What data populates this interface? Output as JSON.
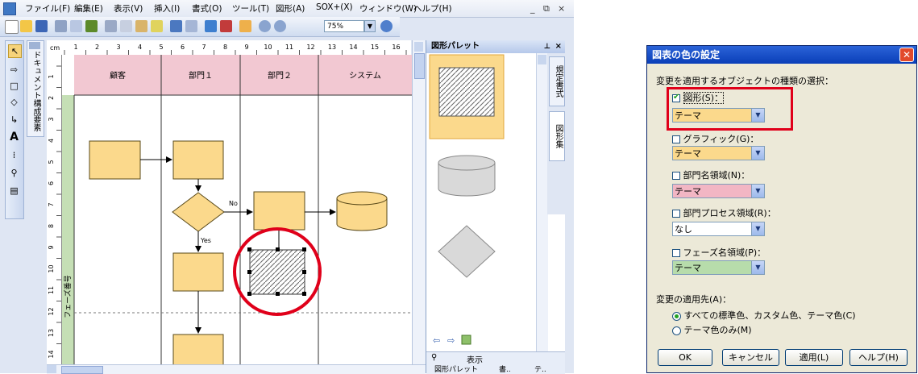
{
  "menu": {
    "items": [
      "ファイル(F)",
      "編集(E)",
      "表示(V)",
      "挿入(I)",
      "書式(O)",
      "ツール(T)",
      "図形(A)",
      "SOX+(X)",
      "ウィンドウ(W)",
      "ヘルプ(H)"
    ],
    "window_controls": [
      "_",
      "⧉",
      "×"
    ]
  },
  "toolbar": {
    "zoom": "75%"
  },
  "left_panel": {
    "label": "ドキュメント構成要素"
  },
  "ruler": {
    "unit": "cm",
    "h_ticks": [
      "1",
      "2",
      "3",
      "4",
      "5",
      "6",
      "7",
      "8",
      "9",
      "10",
      "11",
      "12",
      "13",
      "14",
      "15",
      "16",
      "1"
    ],
    "v_ticks": [
      "1",
      "2",
      "3",
      "4",
      "5",
      "6",
      "7",
      "8",
      "9",
      "10",
      "11",
      "12",
      "13",
      "14"
    ]
  },
  "diagram": {
    "lanes": [
      "顧客",
      "部門１",
      "部門２",
      "システム"
    ],
    "phase_label": "フェーズ番号",
    "yes_label": "Yes",
    "no_label": "No",
    "colors": {
      "lane_header": "#f2c8d2",
      "shape_fill": "#fbd98c",
      "shape_stroke": "#5a4a1a",
      "phase_band": "#c5dfb5",
      "highlight": "#e0001a"
    }
  },
  "palette": {
    "title": "図形パレット",
    "tabs": [
      "規定書式",
      "図形集"
    ],
    "footer": {
      "view_label": "表示",
      "tabs": [
        "図形パレット",
        "書..",
        "テ.."
      ]
    }
  },
  "dialog": {
    "title": "図表の色の設定",
    "section_label": "変更を適用するオブジェクトの種類の選択：",
    "options": [
      {
        "label": "図形(S)：",
        "checked": true,
        "value": "テーマ",
        "color": "#fbd98c"
      },
      {
        "label": "グラフィック(G)：",
        "checked": false,
        "value": "テーマ",
        "color": "#fbd98c"
      },
      {
        "label": "部門名領域(N)：",
        "checked": false,
        "value": "テーマ",
        "color": "#f2b6c4"
      },
      {
        "label": "部門プロセス領域(R)：",
        "checked": false,
        "value": "なし",
        "color": "#ffffff"
      },
      {
        "label": "フェーズ名領域(P)：",
        "checked": false,
        "value": "テーマ",
        "color": "#b7dcab"
      }
    ],
    "apply_to_label": "変更の適用先(A)：",
    "radio_options": [
      {
        "label": "すべての標準色、カスタム色、テーマ色(C)",
        "selected": true
      },
      {
        "label": "テーマ色のみ(M)",
        "selected": false
      }
    ],
    "buttons": {
      "ok": "OK",
      "cancel": "キャンセル",
      "apply": "適用(L)",
      "help": "ヘルプ(H)"
    }
  }
}
